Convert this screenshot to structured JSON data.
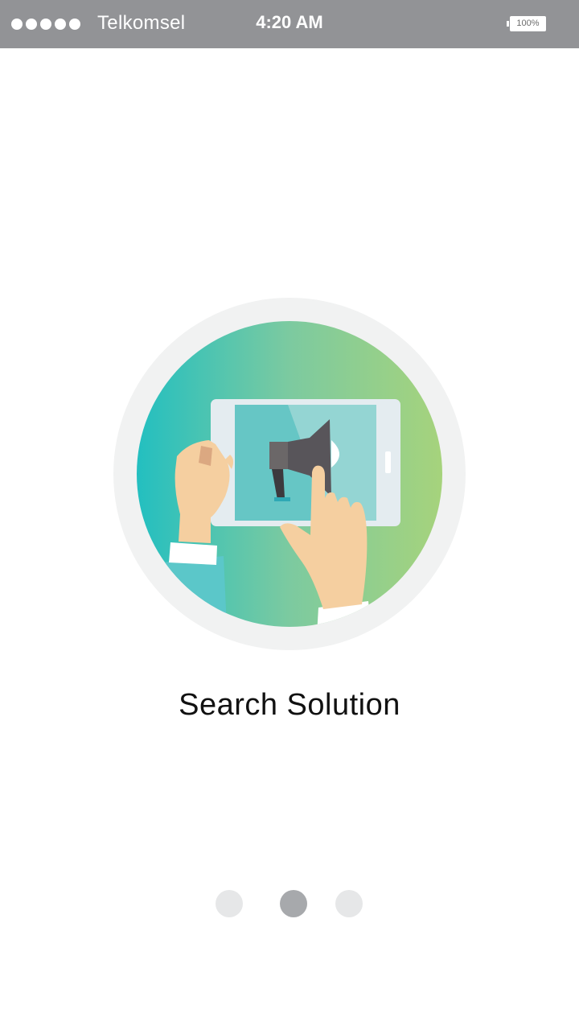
{
  "status_bar": {
    "carrier": "Telkomsel",
    "time": "4:20 AM",
    "battery": "100%",
    "signal_dots": 5
  },
  "onboarding": {
    "illustration": "hands-tablet-megaphone-illustration",
    "title": "Search Solution",
    "pages": 3,
    "current_page": 2
  },
  "colors": {
    "status_bar_bg": "#929396",
    "circle_gradient_start": "#23bfc0",
    "circle_gradient_end": "#a6d37c",
    "pager_active": "#a7a9ac",
    "pager_inactive": "#e6e7e8"
  }
}
